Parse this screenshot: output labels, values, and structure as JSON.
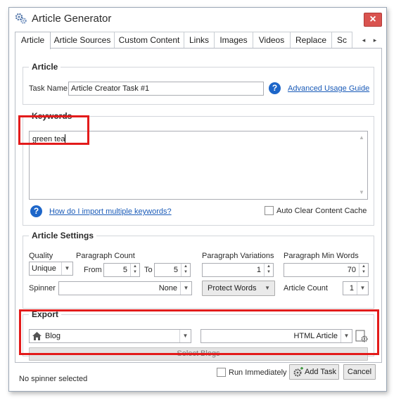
{
  "window": {
    "title": "Article Generator",
    "close_label": "×"
  },
  "tabs": [
    {
      "label": "Article"
    },
    {
      "label": "Article Sources"
    },
    {
      "label": "Custom Content"
    },
    {
      "label": "Links"
    },
    {
      "label": "Images"
    },
    {
      "label": "Videos"
    },
    {
      "label": "Replace"
    },
    {
      "label": "Sc"
    }
  ],
  "tab_scroll": {
    "left": "◂",
    "right": "▸"
  },
  "article": {
    "group_title": "Article",
    "task_name_label": "Task Name",
    "task_name_value": "Article Creator Task #1",
    "help_glyph": "?",
    "guide_link": "Advanced Usage Guide"
  },
  "keywords": {
    "group_title": "Keywords",
    "text": "green tea",
    "import_link": "How do I import multiple keywords?",
    "auto_clear_label": "Auto Clear Content Cache",
    "auto_clear_checked": false
  },
  "settings": {
    "group_title": "Article Settings",
    "quality_label": "Quality",
    "quality_value": "Unique",
    "paragraph_count_label": "Paragraph Count",
    "from_label": "From",
    "from_value": "5",
    "to_label": "To",
    "to_value": "5",
    "variations_label": "Paragraph Variations",
    "variations_value": "1",
    "min_words_label": "Paragraph Min Words",
    "min_words_value": "70",
    "spinner_label": "Spinner",
    "spinner_value": "None",
    "protect_words_label": "Protect Words",
    "article_count_label": "Article Count",
    "article_count_value": "1"
  },
  "export": {
    "group_title": "Export",
    "target_value": "Blog",
    "format_value": "HTML Article",
    "select_blogs_label": "Select Blogs"
  },
  "footer": {
    "status": "No spinner selected",
    "run_immediately_label": "Run Immediately",
    "run_immediately_checked": false,
    "add_task_label": "Add Task",
    "cancel_label": "Cancel"
  },
  "colors": {
    "highlight": "#e31b1b",
    "link": "#1a5bb8",
    "help": "#1d66c9",
    "close": "#d9534f"
  }
}
